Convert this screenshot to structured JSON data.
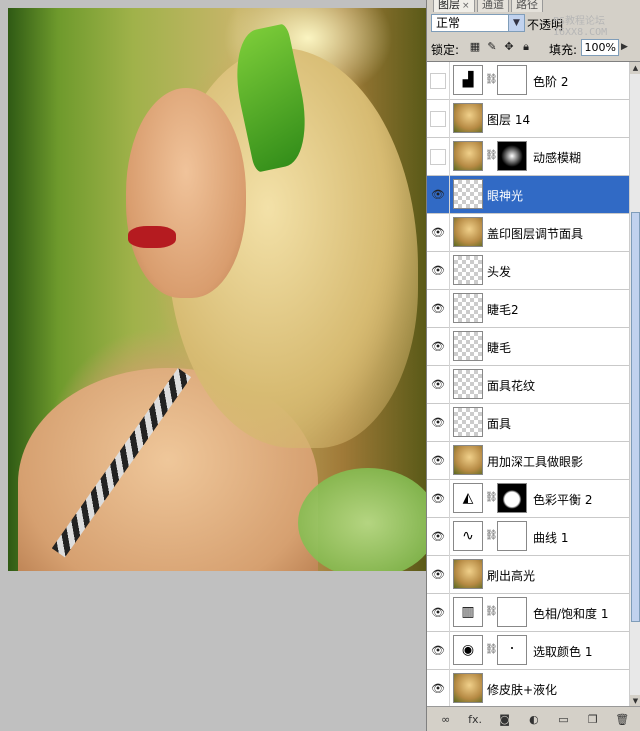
{
  "tabs": [
    {
      "label": "图层",
      "close": "×"
    },
    {
      "label": "通道"
    },
    {
      "label": "路径"
    }
  ],
  "blend_mode": "正常",
  "opacity_label": "不透明",
  "watermark": "PS教程论坛 16XX8.COM",
  "lock_label": "锁定:",
  "fill_label": "填充:",
  "fill_value": "100%",
  "layers": [
    {
      "name": "色阶 2",
      "visible": false,
      "thumb": "adjust-levels",
      "mask": "white"
    },
    {
      "name": "图层 14",
      "visible": false,
      "thumb": "photo"
    },
    {
      "name": "动感模糊",
      "visible": false,
      "thumb": "photo",
      "mask": "dark"
    },
    {
      "name": "眼神光",
      "visible": true,
      "thumb": "transparent",
      "selected": true
    },
    {
      "name": "盖印图层调节面具",
      "visible": true,
      "thumb": "photo"
    },
    {
      "name": "头发",
      "visible": true,
      "thumb": "transparent"
    },
    {
      "name": "睫毛2",
      "visible": true,
      "thumb": "transparent"
    },
    {
      "name": "睫毛",
      "visible": true,
      "thumb": "transparent"
    },
    {
      "name": "面具花纹",
      "visible": true,
      "thumb": "transparent"
    },
    {
      "name": "面具",
      "visible": true,
      "thumb": "transparent"
    },
    {
      "name": "用加深工具做眼影",
      "visible": true,
      "thumb": "photo"
    },
    {
      "name": "色彩平衡 2",
      "visible": true,
      "thumb": "adjust-balance",
      "mask": "balance"
    },
    {
      "name": "曲线 1",
      "visible": true,
      "thumb": "adjust-curves",
      "mask": "white"
    },
    {
      "name": "刷出高光",
      "visible": true,
      "thumb": "photo"
    },
    {
      "name": "色相/饱和度 1",
      "visible": true,
      "thumb": "adjust-hue",
      "mask": "white"
    },
    {
      "name": "选取颜色 1",
      "visible": true,
      "thumb": "adjust-selective",
      "mask": "dot"
    },
    {
      "name": "修皮肤+液化",
      "visible": true,
      "thumb": "photo"
    }
  ],
  "bottom_icons": [
    "link-icon",
    "fx-icon",
    "mask-icon",
    "adjustment-icon",
    "group-icon",
    "new-layer-icon",
    "trash-icon"
  ],
  "bottom_labels": {
    "fx": "fx."
  }
}
